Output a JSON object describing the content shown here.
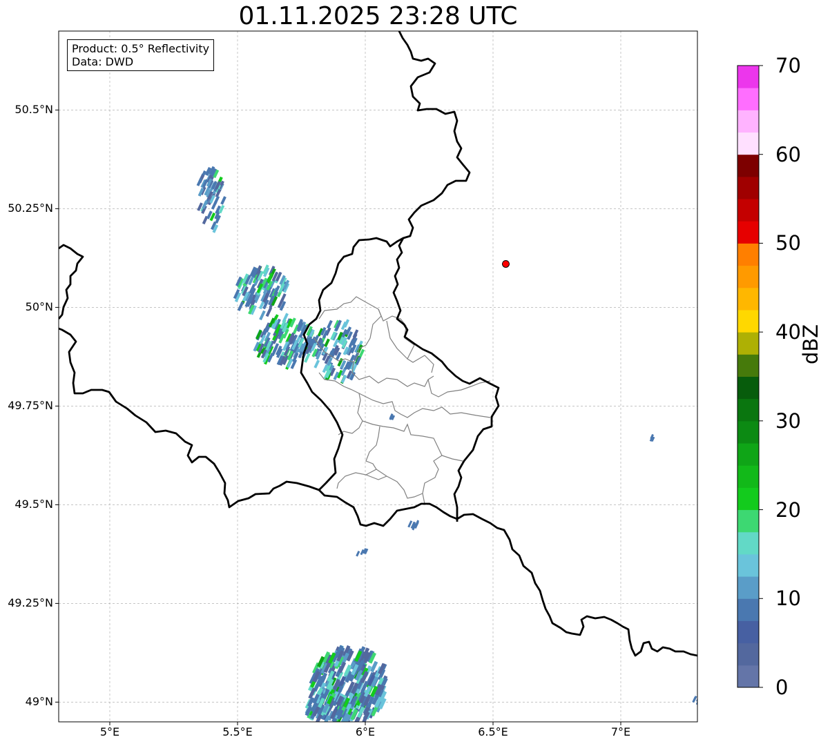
{
  "title": "01.11.2025 23:28 UTC",
  "info_box": {
    "product": "Product: 0.5° Reflectivity",
    "data": "Data: DWD"
  },
  "map": {
    "lon_range": [
      4.8,
      7.3
    ],
    "lat_range": [
      48.95,
      50.7
    ],
    "gridlines": true,
    "lat_ticks": [
      {
        "value": 50.5,
        "label": "50.5°N"
      },
      {
        "value": 50.25,
        "label": "50.25°N"
      },
      {
        "value": 50.0,
        "label": "50°N"
      },
      {
        "value": 49.75,
        "label": "49.75°N"
      },
      {
        "value": 49.5,
        "label": "49.5°N"
      },
      {
        "value": 49.25,
        "label": "49.25°N"
      },
      {
        "value": 49.0,
        "label": "49°N"
      }
    ],
    "lon_ticks": [
      {
        "value": 5.0,
        "label": "5°E"
      },
      {
        "value": 5.5,
        "label": "5.5°E"
      },
      {
        "value": 6.0,
        "label": "6°E"
      },
      {
        "value": 6.5,
        "label": "6.5°E"
      },
      {
        "value": 7.0,
        "label": "7°E"
      }
    ],
    "radar_site": {
      "lon": 6.55,
      "lat": 50.11,
      "color": "#ff0000"
    }
  },
  "colorbar": {
    "label": "dBZ",
    "min": 0,
    "max": 70,
    "ticks": [
      {
        "value": 0,
        "label": "0"
      },
      {
        "value": 10,
        "label": "10"
      },
      {
        "value": 20,
        "label": "20"
      },
      {
        "value": 30,
        "label": "30"
      },
      {
        "value": 40,
        "label": "40"
      },
      {
        "value": 50,
        "label": "50"
      },
      {
        "value": 60,
        "label": "60"
      },
      {
        "value": 70,
        "label": "70"
      }
    ],
    "colors": [
      "#6475a8",
      "#53689e",
      "#4760a2",
      "#4a78b0",
      "#5a9dc8",
      "#6ac4db",
      "#62d9c6",
      "#3dd872",
      "#13cb1d",
      "#12b919",
      "#0fa517",
      "#0c8a13",
      "#0a760f",
      "#075c0c",
      "#467a0b",
      "#aeb004",
      "#ffd800",
      "#ffb700",
      "#ff9a00",
      "#ff7f00",
      "#e60000",
      "#c40000",
      "#a00000",
      "#7d0000",
      "#ffe0ff",
      "#ffb3ff",
      "#ff6eff",
      "#ec36ec"
    ]
  },
  "colors": {
    "border": "#000000",
    "district": "#808080",
    "grid": "#b0b0b0"
  }
}
